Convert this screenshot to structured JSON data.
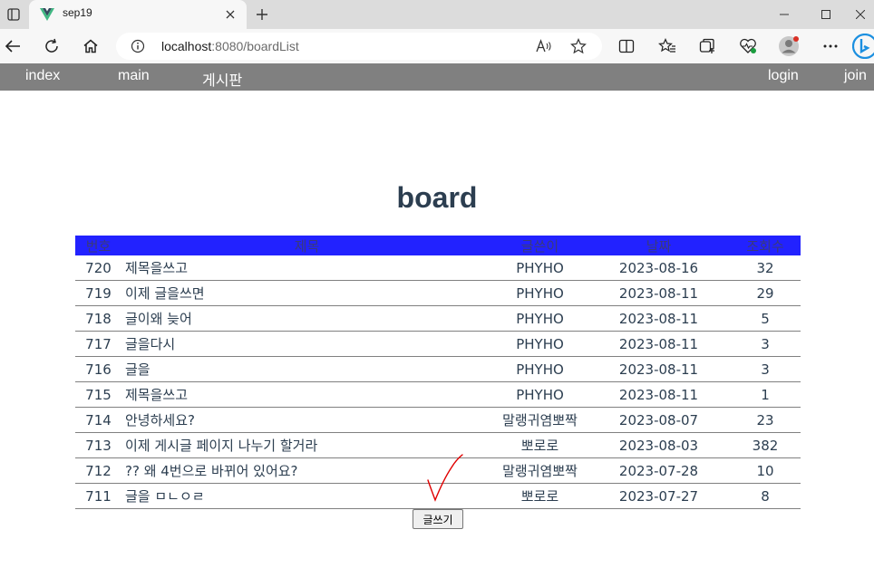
{
  "browser": {
    "tab_title": "sep19",
    "url_host": "localhost",
    "url_rest": ":8080/boardList",
    "colors": {
      "tabbar": "#dcdcdc",
      "toolbar": "#f7f7f7",
      "favicon_green": "#41b883",
      "favicon_dark": "#34495e"
    }
  },
  "nav": {
    "left": [
      "index",
      "main",
      "게시판"
    ],
    "right": [
      "login",
      "join"
    ]
  },
  "board": {
    "title": "board",
    "headers": [
      "번호",
      "제목",
      "글쓴이",
      "날짜",
      "조회수"
    ],
    "rows": [
      {
        "num": "720",
        "title": "제목을쓰고",
        "writer": "PHYHO",
        "date": "2023-08-16",
        "count": "32"
      },
      {
        "num": "719",
        "title": "이제 글을쓰면",
        "writer": "PHYHO",
        "date": "2023-08-11",
        "count": "29"
      },
      {
        "num": "718",
        "title": "글이왜 늦어",
        "writer": "PHYHO",
        "date": "2023-08-11",
        "count": "5"
      },
      {
        "num": "717",
        "title": "글을다시",
        "writer": "PHYHO",
        "date": "2023-08-11",
        "count": "3"
      },
      {
        "num": "716",
        "title": "글을",
        "writer": "PHYHO",
        "date": "2023-08-11",
        "count": "3"
      },
      {
        "num": "715",
        "title": "제목을쓰고",
        "writer": "PHYHO",
        "date": "2023-08-11",
        "count": "1"
      },
      {
        "num": "714",
        "title": "안녕하세요?",
        "writer": "말랭귀염뽀짝",
        "date": "2023-08-07",
        "count": "23"
      },
      {
        "num": "713",
        "title": "이제 게시글 페이지 나누기 할거라",
        "writer": "뽀로로",
        "date": "2023-08-03",
        "count": "382"
      },
      {
        "num": "712",
        "title": "?? 왜 4번으로 바뀌어 있어요?",
        "writer": "말랭귀염뽀짝",
        "date": "2023-07-28",
        "count": "10"
      },
      {
        "num": "711",
        "title": "글을 ㅁㄴㅇㄹ",
        "writer": "뽀로로",
        "date": "2023-07-27",
        "count": "8"
      }
    ],
    "write_label": "글쓰기",
    "colors": {
      "header_bg": "#2222ff",
      "header_text": "#3a3a7a",
      "annotation": "#e00000"
    }
  }
}
